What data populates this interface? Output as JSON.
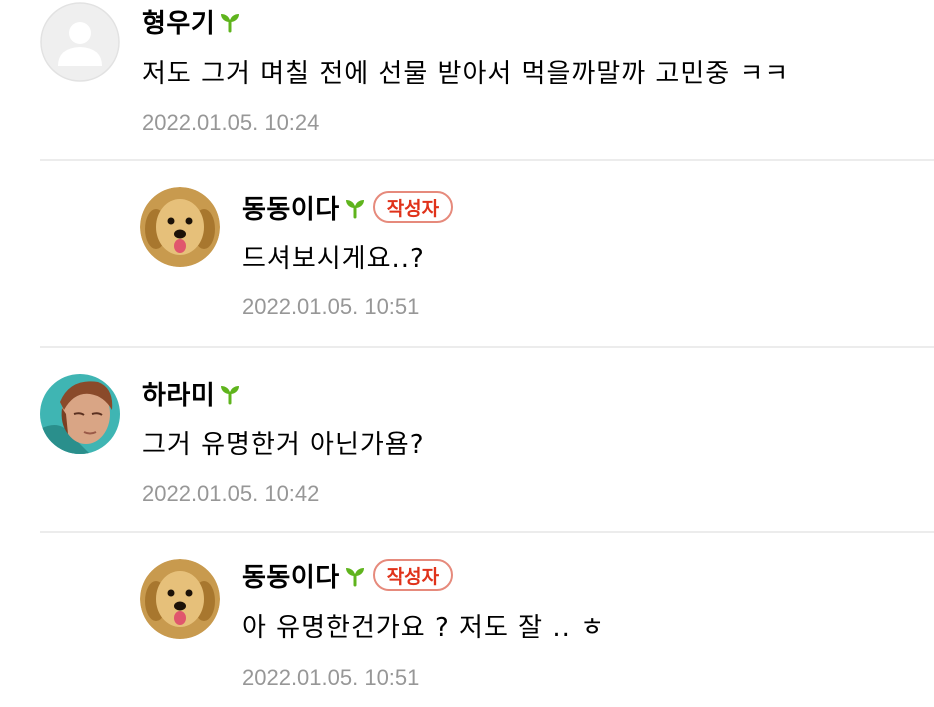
{
  "colors": {
    "date": "#979797",
    "badge_border": "#e68a7c",
    "badge_text": "#e0321a",
    "sprout": "#5fb41d",
    "divider": "#ececec"
  },
  "comments": [
    {
      "nickname": "형우기",
      "level_icon": "sprout-icon",
      "is_author": false,
      "text": "저도 그거 며칠 전에 선물 받아서 먹을까말까 고민중 ㅋㅋ",
      "date": "2022.01.05. 10:24",
      "avatar": "default-profile-icon"
    },
    {
      "nickname": "동동이다",
      "level_icon": "sprout-icon",
      "is_author": true,
      "author_badge": "작성자",
      "text": "드셔보시게요..?",
      "date": "2022.01.05. 10:51",
      "avatar": "puppy-avatar"
    },
    {
      "nickname": "하라미",
      "level_icon": "sprout-icon",
      "is_author": false,
      "text": "그거 유명한거 아닌가욤?",
      "date": "2022.01.05. 10:42",
      "avatar": "person-avatar"
    },
    {
      "nickname": "동동이다",
      "level_icon": "sprout-icon",
      "is_author": true,
      "author_badge": "작성자",
      "text": "아 유명한건가요 ? 저도 잘 .. ㅎ",
      "date": "2022.01.05. 10:51",
      "avatar": "puppy-avatar"
    }
  ]
}
